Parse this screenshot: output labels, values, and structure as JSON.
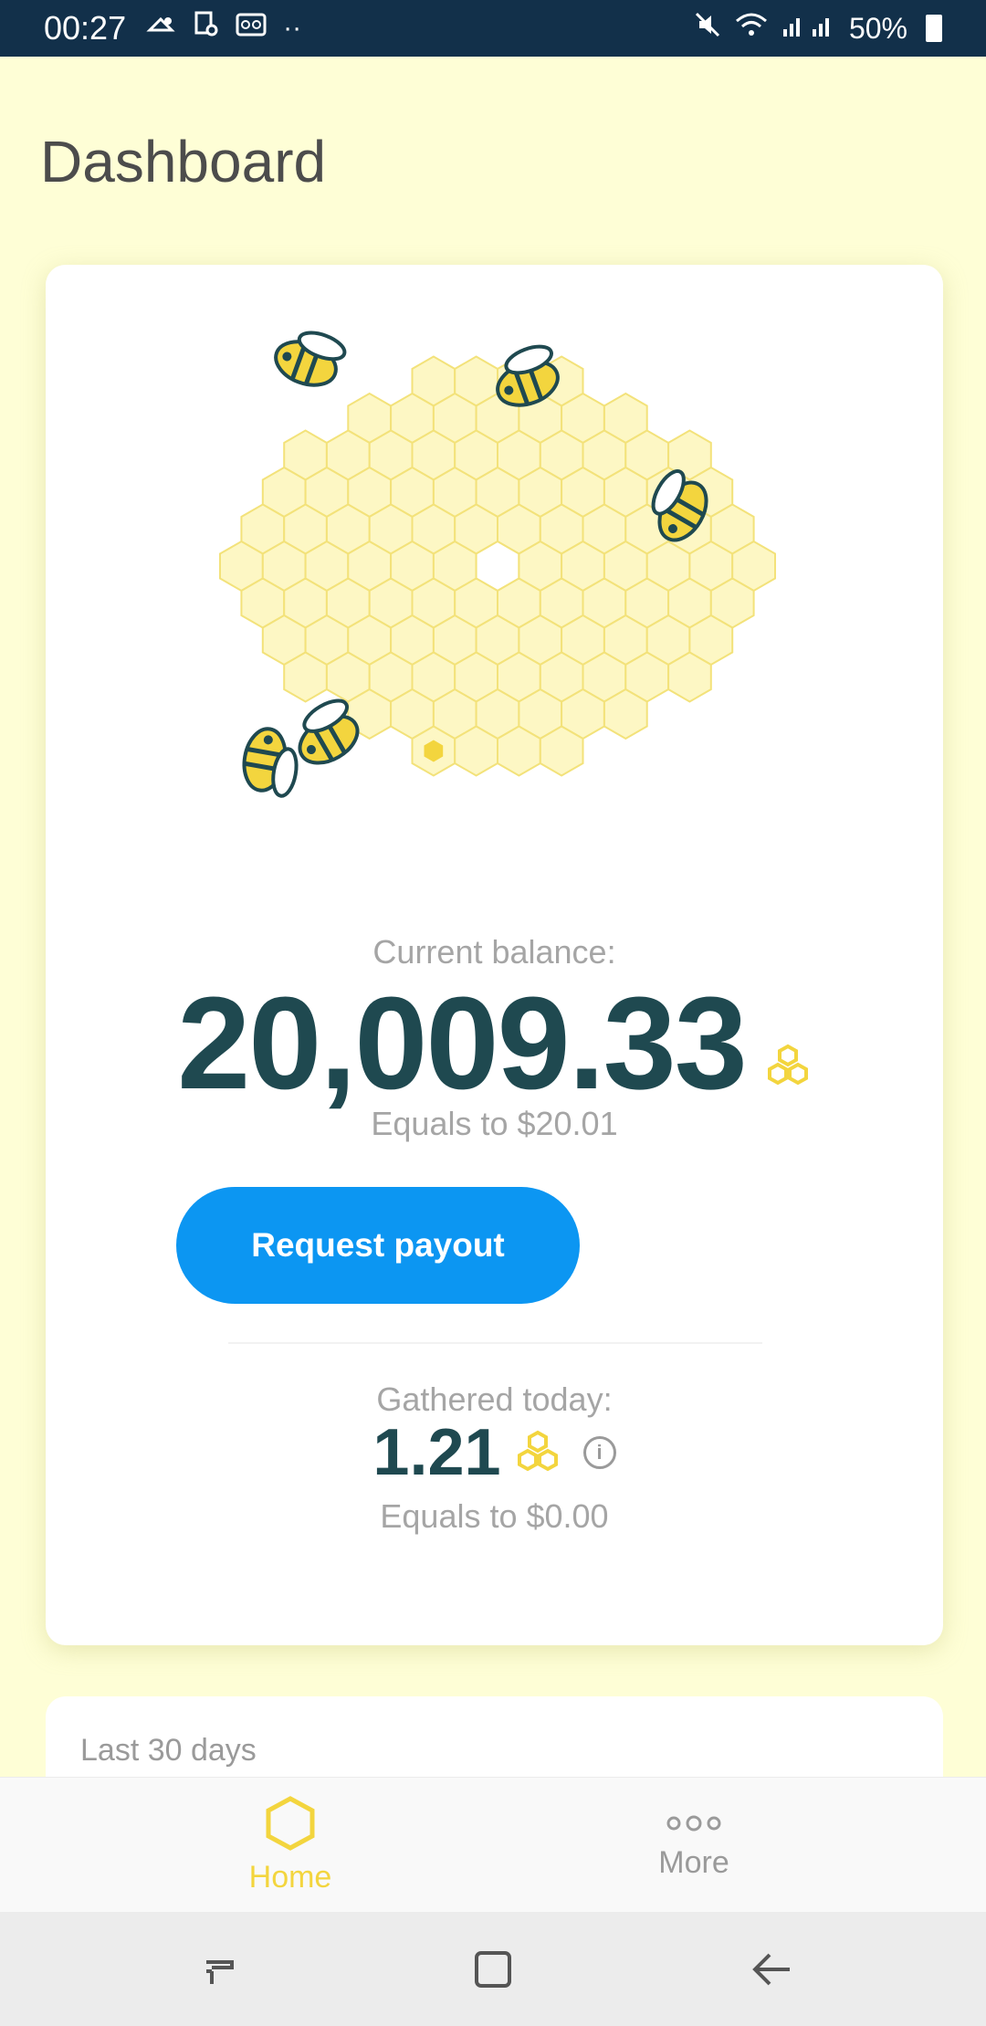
{
  "status_bar": {
    "time": "00:27",
    "battery": "50%",
    "icons": [
      "notification-icon",
      "location-icon",
      "voicemail-icon",
      "mute-icon",
      "wifi-icon",
      "signal-icon",
      "battery-icon"
    ]
  },
  "page": {
    "title": "Dashboard"
  },
  "balance": {
    "label": "Current balance:",
    "value": "20,009.33",
    "equals": "Equals to $20.01"
  },
  "actions": {
    "request_payout": "Request payout"
  },
  "today": {
    "label": "Gathered today:",
    "value": "1.21",
    "info_glyph": "i",
    "equals": "Equals to $0.00"
  },
  "section": {
    "last_30_days": "Last 30 days"
  },
  "bottom_nav": {
    "items": [
      {
        "label": "Home",
        "icon": "hexagon-icon",
        "active": true
      },
      {
        "label": "More",
        "icon": "more-dots-icon",
        "active": false
      }
    ]
  },
  "colors": {
    "accent": "#f3d53e",
    "primary_button": "#0c96f2",
    "balance_text": "#1f4950",
    "background": "#fefed6",
    "status_bar": "#12304a"
  }
}
